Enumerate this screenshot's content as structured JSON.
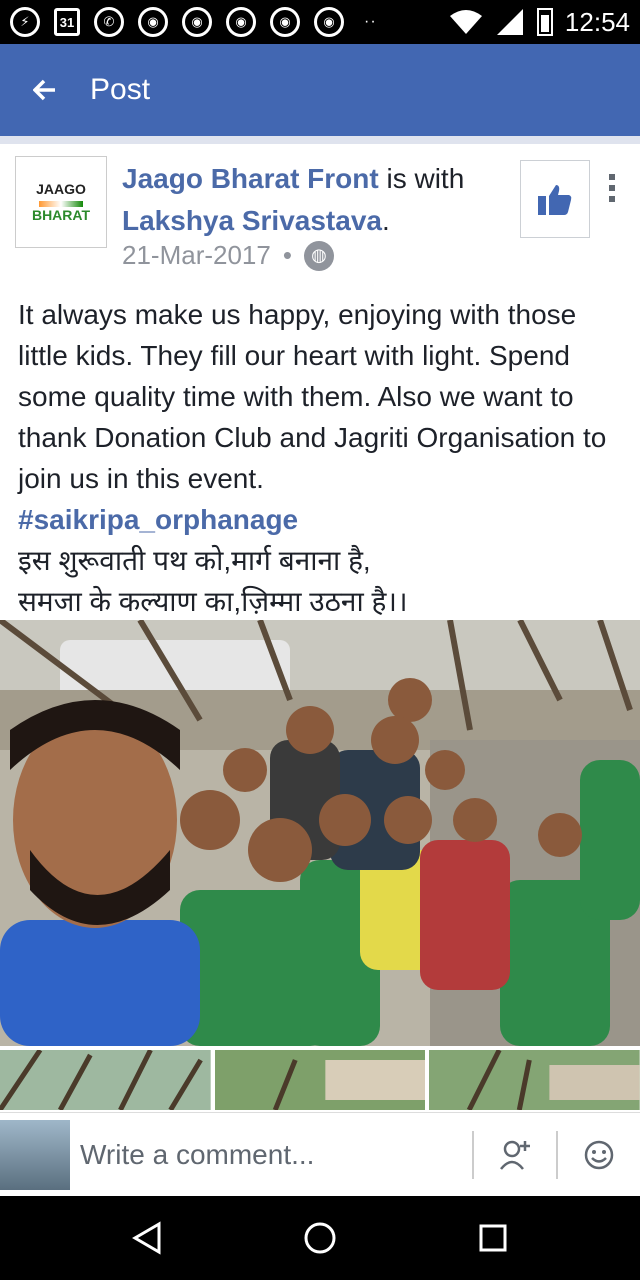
{
  "status_bar": {
    "time": "12:54",
    "calendar_day": "31",
    "notification_icons": [
      "messenger-icon",
      "calendar-icon",
      "whatsapp-icon",
      "chrome-icon",
      "chrome-icon",
      "chrome-icon",
      "chrome-icon",
      "chrome-icon"
    ],
    "overflow_dots": "··"
  },
  "app_bar": {
    "title": "Post",
    "back_icon": "back-arrow-icon"
  },
  "post": {
    "page_name": "Jaago Bharat Front",
    "with_text": " is with ",
    "tagged_user": "Lakshya Srivastava",
    "period": ".",
    "date": "21-Mar-2017",
    "separator": "•",
    "privacy_icon": "globe-icon",
    "avatar_logo_line1": "JAAGO",
    "avatar_logo_line2": "BHARAT",
    "body": "It always make us happy, enjoying with those little kids. They fill our heart with light. Spend some quality time with them. Also we want to thank Donation Club and Jagriti Organisation to join us in this event.",
    "hashtag": "#saikripa_orphanage",
    "hindi_line1": "इस शुरूवाती पथ को,मार्ग बनाना है,",
    "hindi_line2": "समजा के कल्याण का,ज़िम्मा उठना है।।"
  },
  "comment_bar": {
    "placeholder": "Write a comment...",
    "add_friend_icon": "add-person-icon",
    "emoji_icon": "smiley-icon"
  },
  "colors": {
    "brand": "#4267b2",
    "link": "#4b6aa8",
    "text": "#1d2129",
    "meta": "#90949c"
  }
}
